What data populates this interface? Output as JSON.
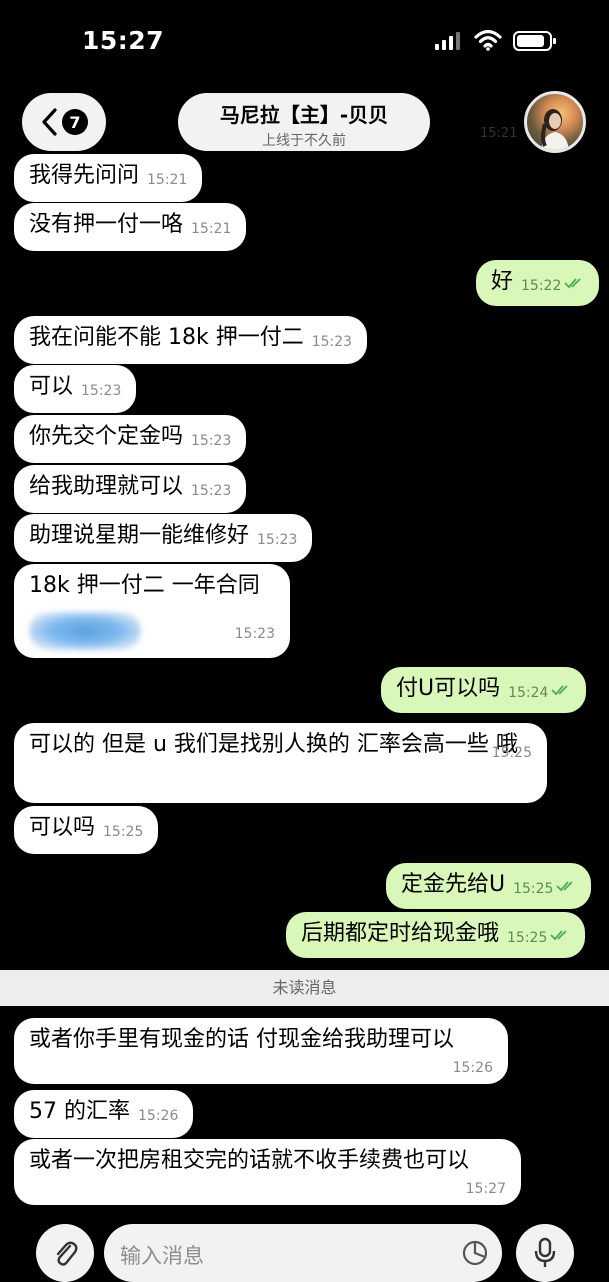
{
  "status_bar": {
    "time": "15:27"
  },
  "header": {
    "back_badge": "7",
    "contact_name": "马尼拉【主】-贝贝",
    "contact_status": "上线于不久前",
    "ghost_time": "15:21"
  },
  "messages": [
    {
      "dir": "in",
      "text": "我得先问问",
      "time": "15:21"
    },
    {
      "dir": "in",
      "text": "没有押一付一咯",
      "time": "15:21"
    },
    {
      "dir": "out",
      "text": "好",
      "time": "15:22"
    },
    {
      "dir": "in",
      "text": "我在问能不能 18k 押一付二",
      "time": "15:23"
    },
    {
      "dir": "in",
      "text": "可以",
      "time": "15:23"
    },
    {
      "dir": "in",
      "text": "你先交个定金吗",
      "time": "15:23"
    },
    {
      "dir": "in",
      "text": "给我助理就可以",
      "time": "15:23"
    },
    {
      "dir": "in",
      "text": "助理说星期一能维修好",
      "time": "15:23"
    },
    {
      "dir": "in",
      "text": "18k 押一付二  一年合同",
      "time": "15:23"
    },
    {
      "dir": "out",
      "text": "付U可以吗",
      "time": "15:24"
    },
    {
      "dir": "in",
      "text": "可以的  但是 u 我们是找别人换的  汇率会高一些 哦",
      "time": "15:25"
    },
    {
      "dir": "in",
      "text": "可以吗",
      "time": "15:25"
    },
    {
      "dir": "out",
      "text": "定金先给U",
      "time": "15:25"
    },
    {
      "dir": "out",
      "text": "后期都定时给现金哦",
      "time": "15:25"
    },
    {
      "dir": "in",
      "text": "或者你手里有现金的话  付现金给我助理可以",
      "time": "15:26"
    },
    {
      "dir": "in",
      "text": "57 的汇率",
      "time": "15:26"
    },
    {
      "dir": "in",
      "text": "或者一次把房租交完的话就不收手续费也可以",
      "time": "15:27"
    }
  ],
  "unread_divider": "未读消息",
  "composer": {
    "placeholder": "输入消息"
  },
  "colors": {
    "incoming": "#ffffff",
    "outgoing": "#d8f7b8",
    "background": "#000000"
  },
  "icons": [
    "signal-icon",
    "wifi-icon",
    "battery-icon",
    "chevron-left-icon",
    "paperclip-icon",
    "sticker-icon",
    "microphone-icon",
    "double-check-icon"
  ]
}
